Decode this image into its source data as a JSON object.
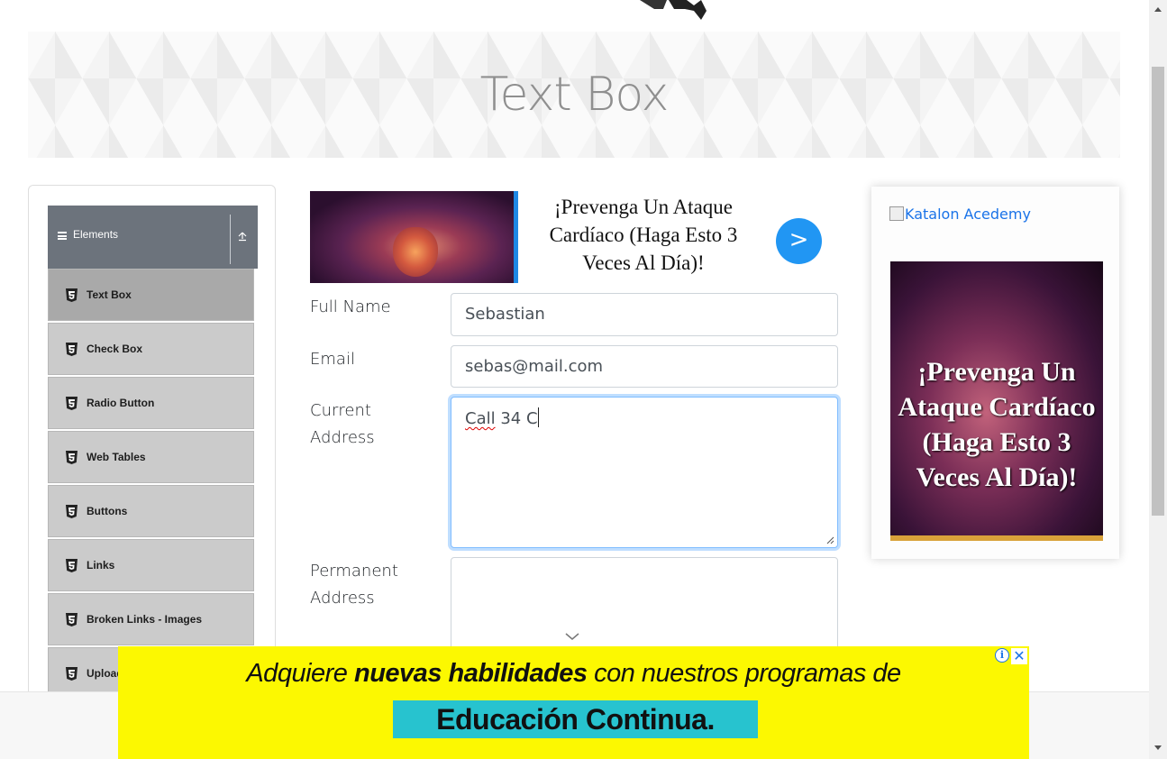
{
  "banner": {
    "title": "Text Box"
  },
  "sidebar": {
    "group": "Elements",
    "items": [
      {
        "label": "Text Box"
      },
      {
        "label": "Check Box"
      },
      {
        "label": "Radio Button"
      },
      {
        "label": "Web Tables"
      },
      {
        "label": "Buttons"
      },
      {
        "label": "Links"
      },
      {
        "label": "Broken Links - Images"
      },
      {
        "label": "Upload and Download"
      }
    ]
  },
  "ad_top": {
    "headline": "¡Prevenga Un Ataque Cardíaco (Haga Esto 3 Veces Al Día)!",
    "button": ">"
  },
  "form": {
    "full_name": {
      "label": "Full Name",
      "value": "Sebastian"
    },
    "email": {
      "label": "Email",
      "value": "sebas@mail.com"
    },
    "current_address": {
      "label": "Current Address",
      "value_word1": "Call",
      "value_rest": " 34 C"
    },
    "permanent_address": {
      "label": "Permanent Address",
      "value": ""
    }
  },
  "ad_right": {
    "broken_image_alt": "Katalon Acedemy",
    "poster_text": "¡Prevenga Un Ataque Cardíaco (Haga Esto 3 Veces Al Día)!"
  },
  "ad_bottom": {
    "line1_pre": "Adquiere ",
    "line1_bold": "nuevas habilidades",
    "line1_post": " con nuestros programas de",
    "line2": "Educación Continua.",
    "info": "i",
    "close": "✕"
  }
}
